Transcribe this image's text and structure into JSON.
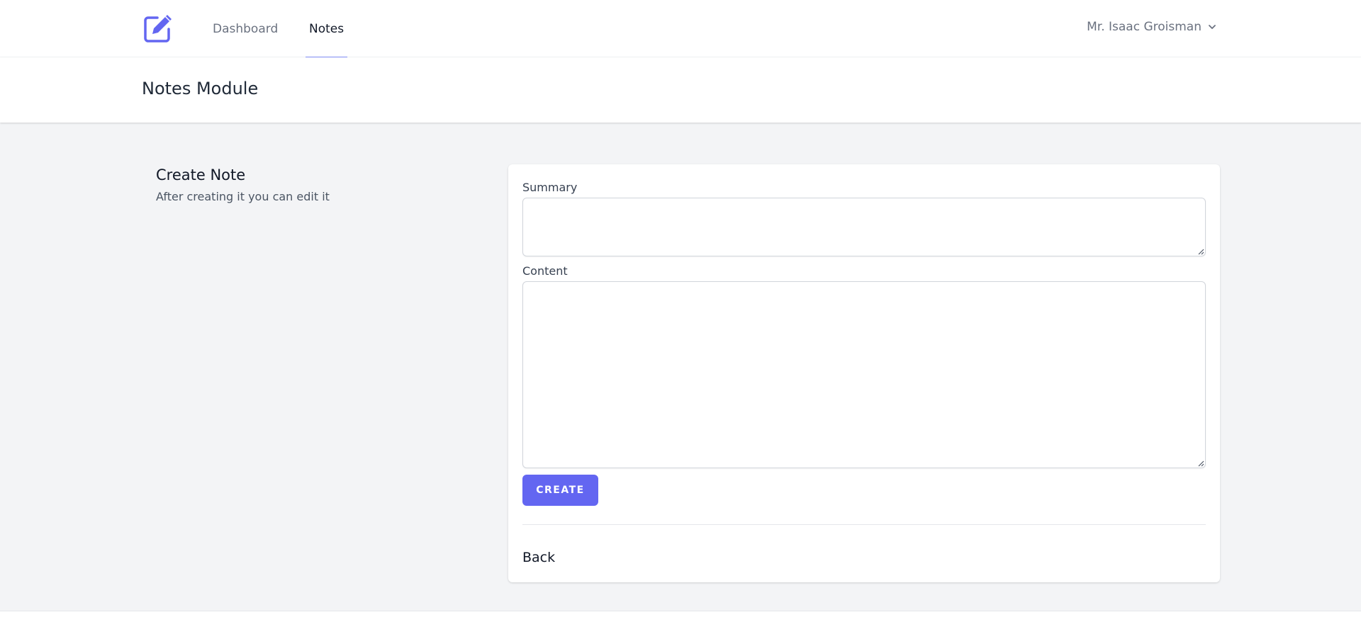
{
  "nav": {
    "logo_icon": "edit-note-icon",
    "links": [
      {
        "label": "Dashboard",
        "active": false
      },
      {
        "label": "Notes",
        "active": true
      }
    ],
    "user_name": "Mr. Isaac Groisman",
    "user_menu_icon": "chevron-down-icon"
  },
  "header": {
    "title": "Notes Module"
  },
  "section": {
    "title": "Create Note",
    "description": "After creating it you can edit it"
  },
  "form": {
    "summary_label": "Summary",
    "summary_value": "",
    "content_label": "Content",
    "content_value": "",
    "create_label": "CREATE",
    "back_label": "Back"
  },
  "colors": {
    "accent": "#6366f1",
    "active_tab_underline": "#818cf8",
    "page_background": "#f3f4f6"
  }
}
